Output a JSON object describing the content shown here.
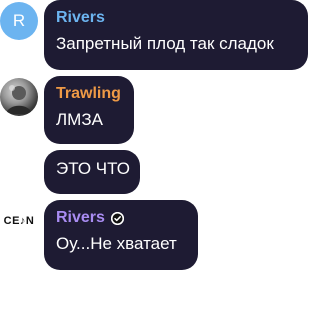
{
  "messages": [
    {
      "avatar": {
        "type": "letter",
        "text": "R",
        "color": "#6cb4f0"
      },
      "sender": "Rivers",
      "sender_color": "#6cb4f0",
      "verified": false,
      "text": "Запретный плод так сладок"
    },
    {
      "avatar": {
        "type": "photo",
        "icon": "user-photo"
      },
      "sender": "Trawling",
      "sender_color": "#ef9a46",
      "verified": false,
      "text": "ЛМЗА"
    },
    {
      "avatar": null,
      "sender": "",
      "verified": false,
      "text": "ЭТО ЧТО"
    },
    {
      "avatar": {
        "type": "logo",
        "text": "CE♪N"
      },
      "sender": "Rivers",
      "sender_color": "#a98cf2",
      "verified": true,
      "badge_icon": "verified-check-icon",
      "text": "Оу...Не хватает"
    }
  ],
  "colors": {
    "bubble_bg": "#1e1b33",
    "message_text": "#ffffff"
  }
}
